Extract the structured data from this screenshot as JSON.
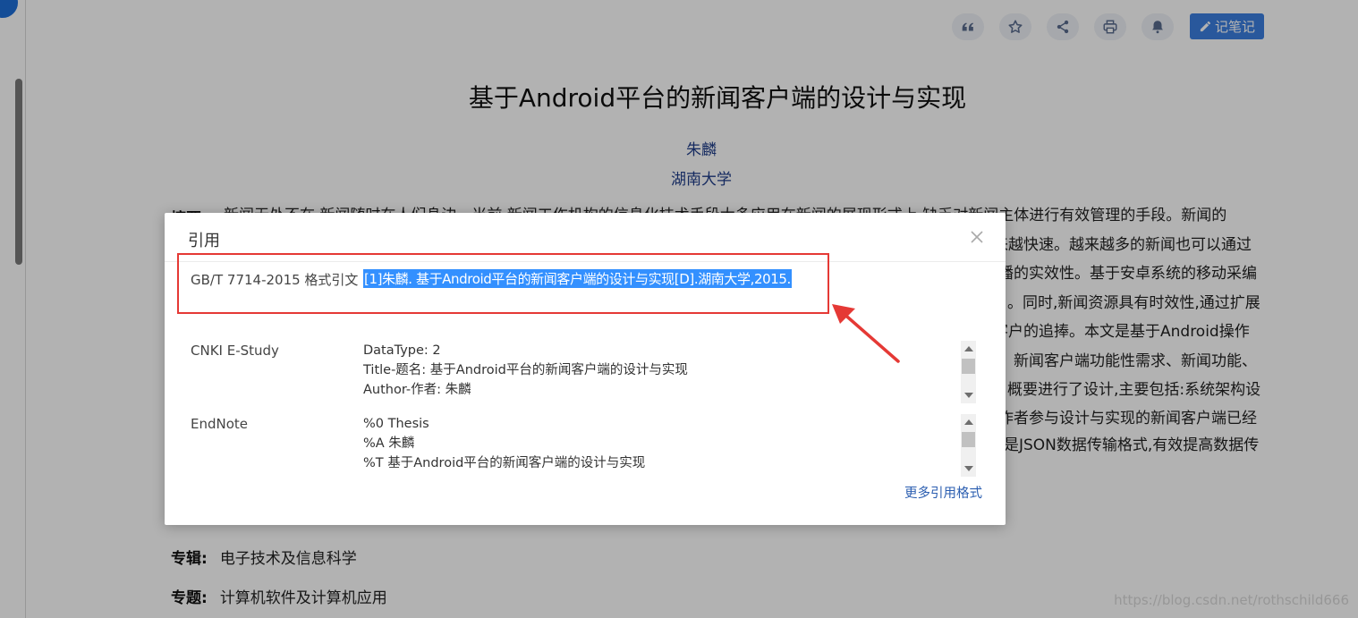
{
  "toolbar": {
    "icons": [
      "quote-icon",
      "star-icon",
      "share-icon",
      "print-icon",
      "bell-icon"
    ],
    "note_label": "记笔记",
    "accent": "#3c7fe0"
  },
  "paper": {
    "title": "基于Android平台的新闻客户端的设计与实现",
    "author": "朱麟",
    "organization": "湖南大学",
    "abstract_label": "摘要",
    "abstract_lines": [
      "新闻无处不在,新闻随时在人们身边。当前,新闻工作机构的信息化技术手段大多应用在新闻的展现形式上,缺乏对新闻主体进行有效管理的手段。新闻的",
      "越来越快速。越来越多的新闻也可以通过",
      "播的实效性。基于安卓系统的移动采编",
      "。同时,新闻资源具有时效性,通过扩展",
      "客户的追捧。本文是基于Android操作",
      "新闻客户端功能性需求、新闻功能、",
      "概要进行了设计,主要包括:系统架构设",
      "作者参与设计与实现的新闻客户端已经",
      "是JSON数据传输格式,有效提高数据传"
    ],
    "meta": [
      {
        "key": "专辑:",
        "value": "电子技术及信息科学"
      },
      {
        "key": "专题:",
        "value": "计算机软件及计算机应用"
      }
    ]
  },
  "watermark": "https://blog.csdn.net/rothschild666",
  "dialog": {
    "title": "引用",
    "gbt_label": "GB/T 7714-2015 格式引文",
    "gbt_citation": "[1]朱麟. 基于Android平台的新闻客户端的设计与实现[D].湖南大学,2015.",
    "highlight_color": "#e53935",
    "formats": [
      {
        "label": "CNKI E-Study",
        "lines": [
          "DataType: 2",
          "Title-题名: 基于Android平台的新闻客户端的设计与实现",
          "Author-作者: 朱麟"
        ]
      },
      {
        "label": "EndNote",
        "lines": [
          "%0 Thesis",
          "%A 朱麟",
          "%T 基于Android平台的新闻客户端的设计与实现"
        ]
      }
    ],
    "more_link": "更多引用格式"
  }
}
